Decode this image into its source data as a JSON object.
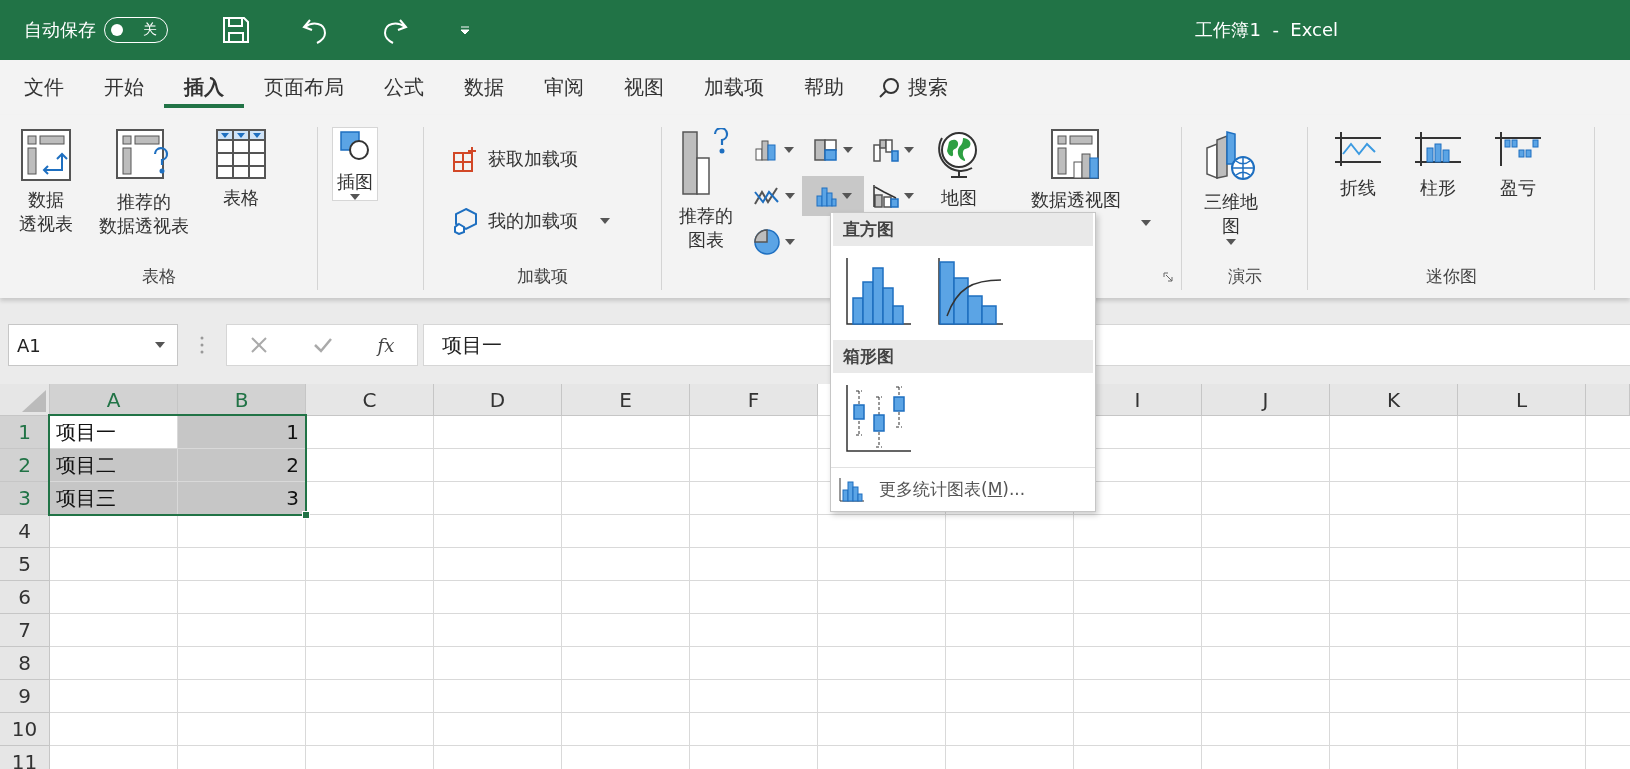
{
  "title_bar": {
    "autosave_label": "自动保存",
    "autosave": {
      "on": false,
      "label": "关"
    },
    "title": "工作簿1  -  Excel"
  },
  "tabs": [
    {
      "label": "文件",
      "selected": false
    },
    {
      "label": "开始",
      "selected": false
    },
    {
      "label": "插入",
      "selected": true
    },
    {
      "label": "页面布局",
      "selected": false
    },
    {
      "label": "公式",
      "selected": false
    },
    {
      "label": "数据",
      "selected": false
    },
    {
      "label": "审阅",
      "selected": false
    },
    {
      "label": "视图",
      "selected": false
    },
    {
      "label": "加载项",
      "selected": false
    },
    {
      "label": "帮助",
      "selected": false
    }
  ],
  "search": {
    "label": "搜索"
  },
  "ribbon": {
    "groups": [
      {
        "kind": "tables",
        "label": "表格",
        "items": [
          {
            "kind": "pivottable",
            "label": [
              "数据",
              "透视表"
            ]
          },
          {
            "kind": "recpivot",
            "label": [
              "推荐的",
              "数据透视表"
            ]
          },
          {
            "kind": "table",
            "label": [
              "表格"
            ]
          }
        ]
      },
      {
        "kind": "illustrations",
        "items": [
          {
            "kind": "shapes",
            "label": [
              "插图"
            ],
            "dropdown": true
          }
        ]
      },
      {
        "kind": "addins",
        "label": "加载项",
        "items": [
          {
            "kind": "store",
            "label": "获取加载项",
            "dropdown": false
          },
          {
            "kind": "myaddins",
            "label": "我的加载项",
            "dropdown": true
          }
        ]
      },
      {
        "kind": "charts",
        "items": [
          {
            "kind": "recchart",
            "label": [
              "推荐的",
              "图表"
            ]
          },
          {
            "kind": "columnchart",
            "pressed": false
          },
          {
            "kind": "linechart",
            "pressed": false
          },
          {
            "kind": "piechart",
            "pressed": false
          },
          {
            "kind": "treemapchart",
            "pressed": false
          },
          {
            "kind": "statchart",
            "pressed": true
          },
          {
            "kind": "waterfallchart",
            "pressed": false
          },
          {
            "kind": "combochart",
            "pressed": false
          },
          {
            "kind": "map",
            "label": [
              "地图"
            ]
          },
          {
            "kind": "pivotchart",
            "label": [
              "数据透视图"
            ],
            "dropdown": true
          }
        ]
      },
      {
        "kind": "tours",
        "label": "演示",
        "items": [
          {
            "kind": "threedmap",
            "label": [
              "三维地",
              "图"
            ],
            "dropdown": true
          }
        ]
      },
      {
        "kind": "sparklines",
        "label": "迷你图",
        "items": [
          {
            "kind": "sparkline",
            "label": [
              "折线"
            ]
          },
          {
            "kind": "sparkcolumn",
            "label": [
              "柱形"
            ]
          },
          {
            "kind": "sparkwinloss",
            "label": [
              "盈亏"
            ]
          }
        ]
      }
    ]
  },
  "formula_bar": {
    "name_box": "A1",
    "function_label": "fx",
    "value": "项目一"
  },
  "grid": {
    "columns": [
      {
        "label": "A",
        "selected": true
      },
      {
        "label": "B",
        "selected": true
      },
      {
        "label": "C",
        "selected": false
      },
      {
        "label": "D",
        "selected": false
      },
      {
        "label": "E",
        "selected": false
      },
      {
        "label": "F",
        "selected": false
      }
    ],
    "columns_right": [
      {
        "label": "I",
        "selected": false
      },
      {
        "label": "J",
        "selected": false
      },
      {
        "label": "K",
        "selected": false
      },
      {
        "label": "L",
        "selected": false
      }
    ],
    "rows": [
      {
        "header": "1",
        "selected": true,
        "cells": [
          {
            "kind": "text",
            "text": "项目一",
            "selected": true,
            "active": true
          },
          {
            "kind": "number",
            "text": "1",
            "selected": true,
            "active": false
          }
        ]
      },
      {
        "header": "2",
        "selected": true,
        "cells": [
          {
            "kind": "text",
            "text": "项目二",
            "selected": true,
            "active": false
          },
          {
            "kind": "number",
            "text": "2",
            "selected": true,
            "active": false
          }
        ]
      },
      {
        "header": "3",
        "selected": true,
        "cells": [
          {
            "kind": "text",
            "text": "项目三",
            "selected": true,
            "active": false
          },
          {
            "kind": "number",
            "text": "3",
            "selected": true,
            "active": false
          }
        ]
      },
      {
        "header": "4",
        "selected": false,
        "cells": []
      },
      {
        "header": "5",
        "selected": false,
        "cells": []
      },
      {
        "header": "6",
        "selected": false,
        "cells": []
      },
      {
        "header": "7",
        "selected": false,
        "cells": []
      },
      {
        "header": "8",
        "selected": false,
        "cells": []
      },
      {
        "header": "9",
        "selected": false,
        "cells": []
      },
      {
        "header": "10",
        "selected": false,
        "cells": []
      },
      {
        "header": "11",
        "selected": false,
        "cells": []
      }
    ]
  },
  "dropdown": {
    "sections": [
      {
        "title": "直方图",
        "charts": [
          {
            "kind": "histogram"
          },
          {
            "kind": "pareto"
          }
        ]
      },
      {
        "title": "箱形图",
        "charts": [
          {
            "kind": "box-whisker"
          }
        ]
      }
    ],
    "more": {
      "before": "更多统计图表(",
      "access_key": "M",
      "after": ")..."
    }
  }
}
